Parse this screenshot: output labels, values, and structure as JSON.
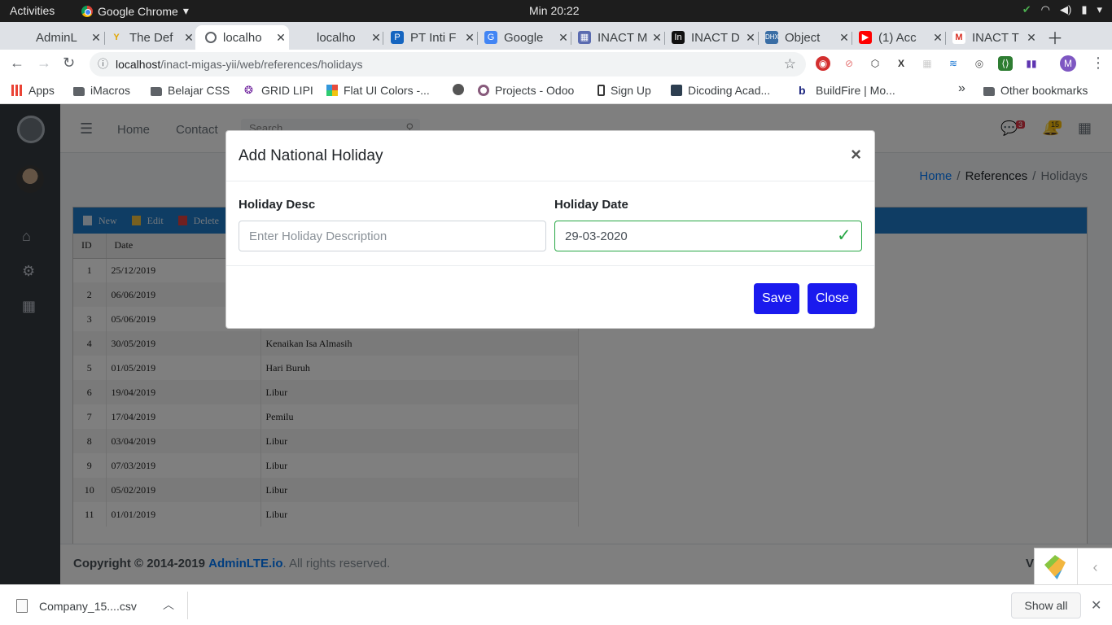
{
  "os_bar": {
    "activities": "Activities",
    "app_name": "Google Chrome",
    "clock": "Min 20:22"
  },
  "tabs": [
    {
      "title": "AdminL",
      "active": false
    },
    {
      "title": "The Def",
      "active": false
    },
    {
      "title": "localho",
      "active": true
    },
    {
      "title": "localho",
      "active": false
    },
    {
      "title": "PT Inti F",
      "active": false
    },
    {
      "title": "Google",
      "active": false
    },
    {
      "title": "INACT M",
      "active": false
    },
    {
      "title": "INACT D",
      "active": false
    },
    {
      "title": "Object",
      "active": false
    },
    {
      "title": "(1) Acc",
      "active": false
    },
    {
      "title": "INACT T",
      "active": false
    }
  ],
  "address": {
    "host": "localhost",
    "path": "/inact-migas-yii/web/references/holidays"
  },
  "bookmarks": {
    "apps": "Apps",
    "items": [
      "iMacros",
      "Belajar CSS",
      "GRID LIPI",
      "Flat UI Colors -...",
      "",
      "Projects - Odoo",
      "Sign Up",
      "Dicoding Acad...",
      "BuildFire | Mo..."
    ],
    "overflow": "»",
    "other": "Other bookmarks"
  },
  "profile_initial": "M",
  "header": {
    "nav_home": "Home",
    "nav_contact": "Contact",
    "search_placeholder": "Search",
    "messages_badge": "3",
    "notifications_badge": "15"
  },
  "breadcrumb": {
    "home": "Home",
    "section": "References",
    "current": "Holidays"
  },
  "grid_toolbar": {
    "new": "New",
    "edit": "Edit",
    "delete": "Delete"
  },
  "grid": {
    "columns": [
      "ID",
      "Date"
    ],
    "rows": [
      {
        "id": "1",
        "date": "25/12/2019",
        "desc": ""
      },
      {
        "id": "2",
        "date": "06/06/2019",
        "desc": ""
      },
      {
        "id": "3",
        "date": "05/06/2019",
        "desc": ""
      },
      {
        "id": "4",
        "date": "30/05/2019",
        "desc": "Kenaikan Isa Almasih"
      },
      {
        "id": "5",
        "date": "01/05/2019",
        "desc": "Hari Buruh"
      },
      {
        "id": "6",
        "date": "19/04/2019",
        "desc": "Libur"
      },
      {
        "id": "7",
        "date": "17/04/2019",
        "desc": "Pemilu"
      },
      {
        "id": "8",
        "date": "03/04/2019",
        "desc": "Libur"
      },
      {
        "id": "9",
        "date": "07/03/2019",
        "desc": "Libur"
      },
      {
        "id": "10",
        "date": "05/02/2019",
        "desc": "Libur"
      },
      {
        "id": "11",
        "date": "01/01/2019",
        "desc": "Libur"
      }
    ]
  },
  "footer": {
    "copyright": "Copyright © 2014-2019",
    "brand": "AdminLTE.io",
    "suffix": ". All rights reserved.",
    "version_hint": "V"
  },
  "modal": {
    "title": "Add National Holiday",
    "close_symbol": "×",
    "field_desc_label": "Holiday Desc",
    "field_desc_placeholder": "Enter Holiday Description",
    "field_desc_value": "",
    "field_date_label": "Holiday Date",
    "field_date_value": "29-03-2020",
    "save_label": "Save",
    "close_label": "Close"
  },
  "download_bar": {
    "filename": "Company_15....csv",
    "show_all": "Show all"
  },
  "colors": {
    "primary_button": "#1a1aee",
    "valid_green": "#28a745",
    "grid_toolbar": "#1e7ac8",
    "sidebar": "#343a40"
  }
}
